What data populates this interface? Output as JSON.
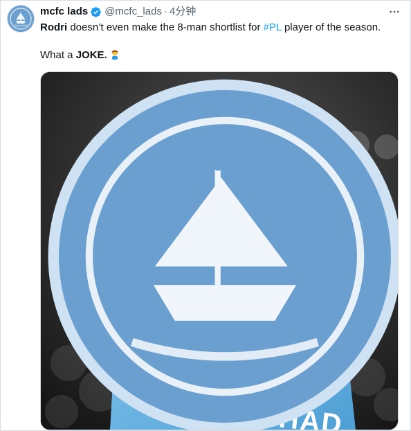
{
  "tweet": {
    "author": {
      "display_name": "mcfc lads",
      "handle": "@mcfc_lads",
      "separator": "·",
      "time": "4分钟",
      "avatar_icon": "ship-crest-icon",
      "verified": true
    },
    "text": {
      "line1_bold": "Rodri",
      "line1_part1": " doesn’t even make the 8-man shortlist for ",
      "hashtag": "#PL",
      "line1_part2": " player of the season.",
      "line2_part1": "What a ",
      "line2_bold": "JOKE.",
      "emoji": "facepalm-emoji"
    },
    "media": {
      "watermark_icon": "mcfc-lads-crest-icon",
      "shirt_text": "ETIHAD"
    }
  },
  "colors": {
    "text": "#0f1419",
    "secondary": "#536471",
    "link": "#1d9bf0",
    "verified": "#1d9bf0",
    "avatar_bg": "#6a9fd0",
    "shirt": "#6cb6e4"
  }
}
